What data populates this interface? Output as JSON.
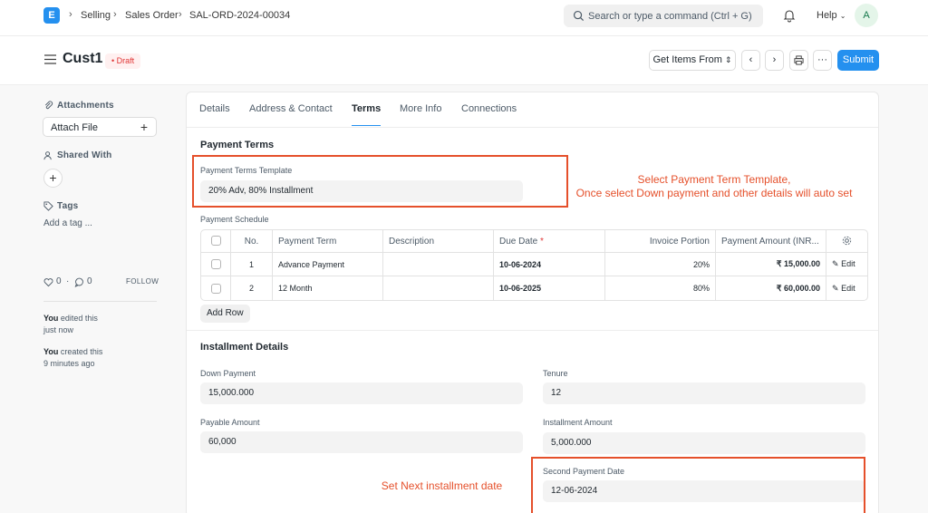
{
  "navbar": {
    "logo": "E",
    "breadcrumbs": [
      "Selling",
      "Sales Order",
      "SAL-ORD-2024-00034"
    ],
    "search_placeholder": "Search or type a command (Ctrl + G)",
    "help_label": "Help",
    "avatar_initial": "A"
  },
  "page": {
    "title": "Cust1",
    "status": "Draft",
    "get_items_label": "Get Items From",
    "submit_label": "Submit"
  },
  "sidebar": {
    "attachments_label": "Attachments",
    "attach_file_label": "Attach File",
    "shared_with_label": "Shared With",
    "tags_label": "Tags",
    "add_tag_label": "Add a tag ...",
    "likes_count": "0",
    "comments_count": "0",
    "follow_label": "FOLLOW",
    "activity": [
      {
        "who": "You",
        "what": "edited this",
        "when": "just now"
      },
      {
        "who": "You",
        "what": "created this",
        "when": "9 minutes ago"
      }
    ]
  },
  "tabs": [
    "Details",
    "Address & Contact",
    "Terms",
    "More Info",
    "Connections"
  ],
  "active_tab": "Terms",
  "payment_terms": {
    "section_title": "Payment Terms",
    "template_label": "Payment Terms Template",
    "template_value": "20% Adv, 80% Installment",
    "schedule_label": "Payment Schedule",
    "columns": [
      "No.",
      "Payment Term",
      "Description",
      "Due Date",
      "Invoice Portion",
      "Payment Amount (INR..."
    ],
    "required_mark": "*",
    "edit_label": "Edit",
    "rows": [
      {
        "no": "1",
        "term": "Advance Payment",
        "description": "",
        "due_date": "10-06-2024",
        "portion": "20%",
        "amount": "₹ 15,000.00"
      },
      {
        "no": "2",
        "term": "12 Month",
        "description": "",
        "due_date": "10-06-2025",
        "portion": "80%",
        "amount": "₹ 60,000.00"
      }
    ],
    "add_row_label": "Add Row"
  },
  "installment": {
    "section_title": "Installment Details",
    "down_payment_label": "Down Payment",
    "down_payment_value": "15,000.000",
    "tenure_label": "Tenure",
    "tenure_value": "12",
    "payable_amount_label": "Payable Amount",
    "payable_amount_value": "60,000",
    "installment_amount_label": "Installment Amount",
    "installment_amount_value": "5,000.000",
    "second_payment_date_label": "Second Payment Date",
    "second_payment_date_value": "12-06-2024"
  },
  "annotations": {
    "template_note_line1": "Select Payment Term Template,",
    "template_note_line2": "Once select Down payment and other details will auto set",
    "date_note": "Set Next installment date"
  },
  "colors": {
    "accent": "#2490ef",
    "annotation": "#e5502b",
    "draft": "#e03636"
  }
}
